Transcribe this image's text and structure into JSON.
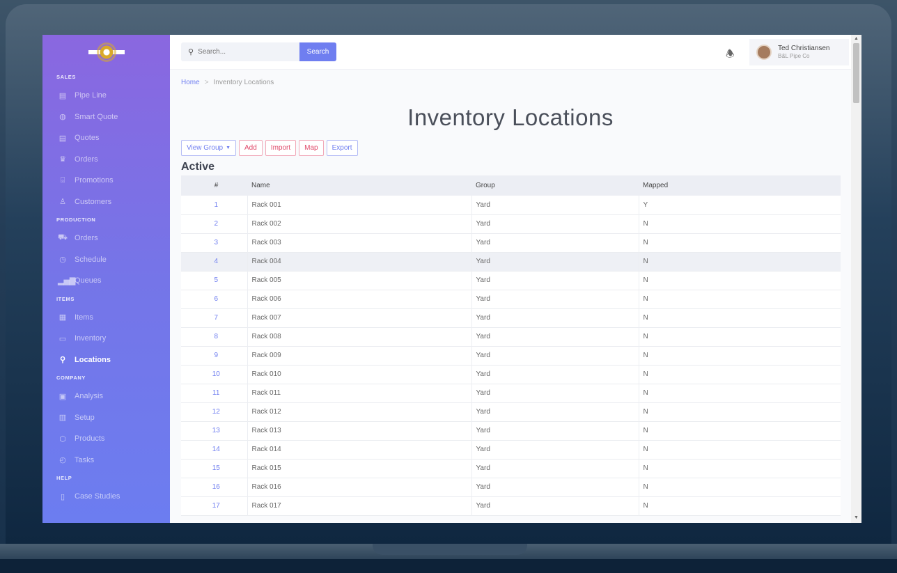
{
  "sidebar": {
    "sections": [
      {
        "label": "SALES",
        "items": [
          {
            "label": "Pipe Line",
            "icon": "columns-icon",
            "glyph": "▤",
            "active": false
          },
          {
            "label": "Smart Quote",
            "icon": "smart-quote-icon",
            "glyph": "◍",
            "active": false
          },
          {
            "label": "Quotes",
            "icon": "document-icon",
            "glyph": "▤",
            "active": false
          },
          {
            "label": "Orders",
            "icon": "basket-icon",
            "glyph": "♛",
            "active": false
          },
          {
            "label": "Promotions",
            "icon": "gift-icon",
            "glyph": "⌺",
            "active": false
          },
          {
            "label": "Customers",
            "icon": "user-icon",
            "glyph": "♙",
            "active": false
          }
        ]
      },
      {
        "label": "PRODUCTION",
        "items": [
          {
            "label": "Orders",
            "icon": "cart-icon",
            "glyph": "⛟",
            "active": false
          },
          {
            "label": "Schedule",
            "icon": "clock-icon",
            "glyph": "◷",
            "active": false
          },
          {
            "label": "Queues",
            "icon": "bar-chart-icon",
            "glyph": "▂▅▇",
            "active": false
          }
        ]
      },
      {
        "label": "ITEMS",
        "items": [
          {
            "label": "Items",
            "icon": "grid-icon",
            "glyph": "▦",
            "active": false
          },
          {
            "label": "Inventory",
            "icon": "archive-icon",
            "glyph": "▭",
            "active": false
          },
          {
            "label": "Locations",
            "icon": "location-pin-icon",
            "glyph": "⚲",
            "active": true
          }
        ]
      },
      {
        "label": "COMPANY",
        "items": [
          {
            "label": "Analysis",
            "icon": "report-icon",
            "glyph": "▣",
            "active": false
          },
          {
            "label": "Setup",
            "icon": "building-icon",
            "glyph": "▥",
            "active": false
          },
          {
            "label": "Products",
            "icon": "box-icon",
            "glyph": "⬡",
            "active": false
          },
          {
            "label": "Tasks",
            "icon": "stopwatch-icon",
            "glyph": "◴",
            "active": false
          }
        ]
      },
      {
        "label": "HELP",
        "items": [
          {
            "label": "Case Studies",
            "icon": "book-icon",
            "glyph": "▯",
            "active": false
          }
        ]
      }
    ]
  },
  "topbar": {
    "search_placeholder": "Search...",
    "search_button": "Search",
    "user_name": "Ted Christiansen",
    "user_company": "B&L Pipe Co"
  },
  "breadcrumb": {
    "home": "Home",
    "separator": ">",
    "current": "Inventory Locations"
  },
  "page_title": "Inventory Locations",
  "actions": {
    "view_group": "View Group",
    "add": "Add",
    "import": "Import",
    "map": "Map",
    "export": "Export"
  },
  "section_heading": "Active",
  "table": {
    "columns": [
      "#",
      "Name",
      "Group",
      "Mapped"
    ],
    "highlighted_row": 4,
    "rows": [
      {
        "num": "1",
        "name": "Rack 001",
        "group": "Yard",
        "mapped": "Y"
      },
      {
        "num": "2",
        "name": "Rack 002",
        "group": "Yard",
        "mapped": "N"
      },
      {
        "num": "3",
        "name": "Rack 003",
        "group": "Yard",
        "mapped": "N"
      },
      {
        "num": "4",
        "name": "Rack 004",
        "group": "Yard",
        "mapped": "N"
      },
      {
        "num": "5",
        "name": "Rack 005",
        "group": "Yard",
        "mapped": "N"
      },
      {
        "num": "6",
        "name": "Rack 006",
        "group": "Yard",
        "mapped": "N"
      },
      {
        "num": "7",
        "name": "Rack 007",
        "group": "Yard",
        "mapped": "N"
      },
      {
        "num": "8",
        "name": "Rack 008",
        "group": "Yard",
        "mapped": "N"
      },
      {
        "num": "9",
        "name": "Rack 009",
        "group": "Yard",
        "mapped": "N"
      },
      {
        "num": "10",
        "name": "Rack 010",
        "group": "Yard",
        "mapped": "N"
      },
      {
        "num": "11",
        "name": "Rack 011",
        "group": "Yard",
        "mapped": "N"
      },
      {
        "num": "12",
        "name": "Rack 012",
        "group": "Yard",
        "mapped": "N"
      },
      {
        "num": "13",
        "name": "Rack 013",
        "group": "Yard",
        "mapped": "N"
      },
      {
        "num": "14",
        "name": "Rack 014",
        "group": "Yard",
        "mapped": "N"
      },
      {
        "num": "15",
        "name": "Rack 015",
        "group": "Yard",
        "mapped": "N"
      },
      {
        "num": "16",
        "name": "Rack 016",
        "group": "Yard",
        "mapped": "N"
      },
      {
        "num": "17",
        "name": "Rack 017",
        "group": "Yard",
        "mapped": "N"
      }
    ]
  },
  "colors": {
    "accent": "#6f7ef0",
    "danger": "#e0496a",
    "sidebar_top": "#8a67e0",
    "sidebar_bottom": "#6c7df0"
  }
}
